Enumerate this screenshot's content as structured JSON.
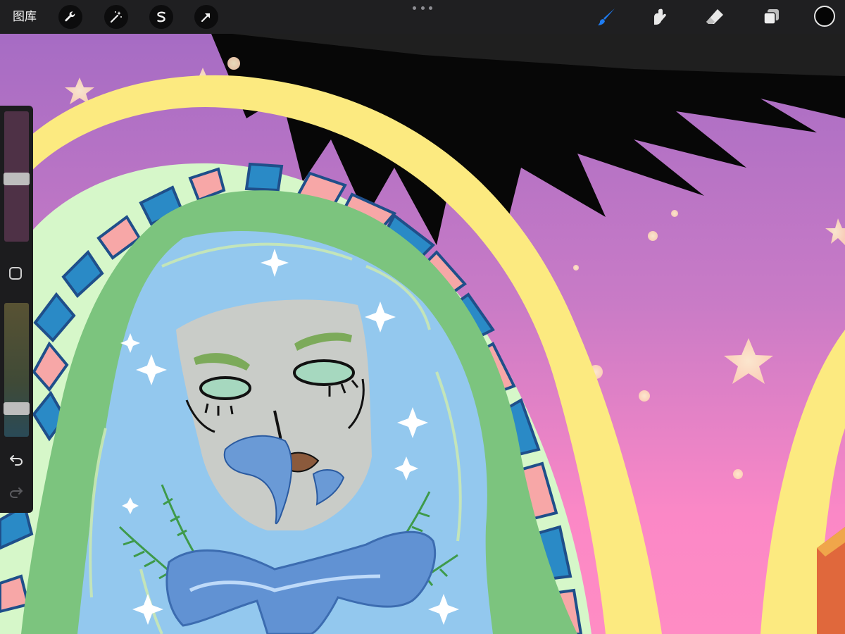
{
  "toolbar": {
    "gallery_label": "图库",
    "left_tools": [
      "wrench-icon",
      "magic-wand-icon",
      "selection-s-icon",
      "transform-arrow-icon"
    ],
    "right_tools": [
      "brush-icon",
      "smudge-icon",
      "eraser-icon",
      "layers-icon"
    ],
    "active_tool": "brush-icon",
    "current_color": "#050505",
    "accent_color": "#1e7cf2"
  },
  "sidebar": {
    "brush_size_level": 0.48,
    "brush_opacity_level": 0.18,
    "modify_button_icon": "square-icon",
    "undo_icon": "undo-icon",
    "redo_icon": "redo-icon",
    "redo_enabled": false
  }
}
